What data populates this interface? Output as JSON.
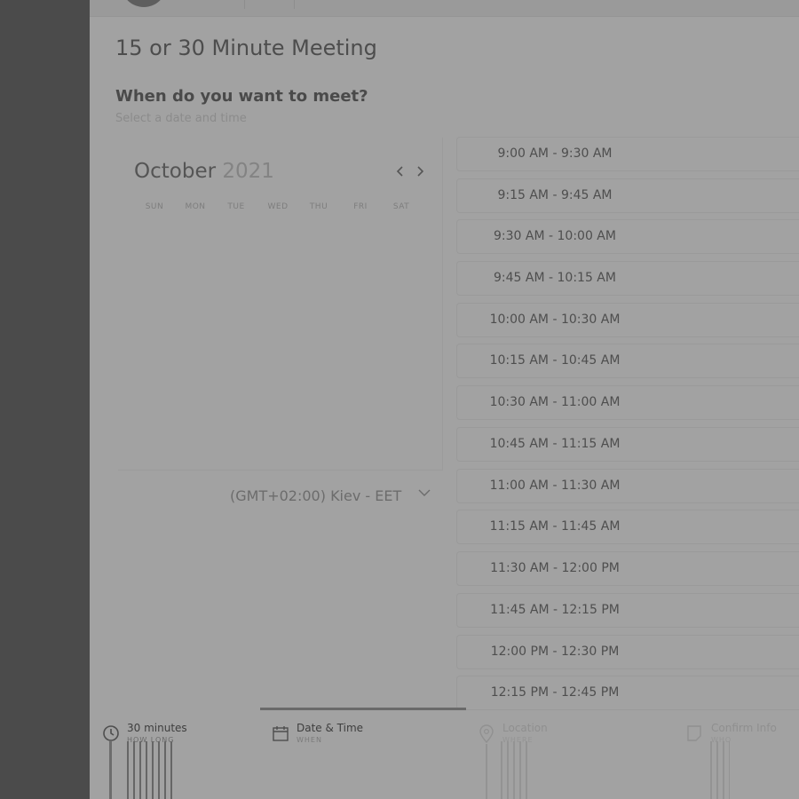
{
  "meeting": {
    "title": "15 or 30 Minute Meeting",
    "question": "When do you want to meet?",
    "hint": "Select a date and time"
  },
  "calendar": {
    "month": "October",
    "year": "2021",
    "prev_icon": "chevron-left-icon",
    "next_icon": "chevron-right-icon",
    "weekdays": [
      "SUN",
      "MON",
      "TUE",
      "WED",
      "THU",
      "FRI",
      "SAT"
    ]
  },
  "timezone": {
    "value": "(GMT+02:00) Kiev - EET",
    "icon": "chevron-down-icon"
  },
  "slots": [
    "9:00 AM - 9:30 AM",
    "9:15 AM - 9:45 AM",
    "9:30 AM - 10:00 AM",
    "9:45 AM - 10:15 AM",
    "10:00 AM - 10:30 AM",
    "10:15 AM - 10:45 AM",
    "10:30 AM - 11:00 AM",
    "10:45 AM - 11:15 AM",
    "11:00 AM - 11:30 AM",
    "11:15 AM - 11:45 AM",
    "11:30 AM - 12:00 PM",
    "11:45 AM - 12:15 PM",
    "12:00 PM - 12:30 PM",
    "12:15 PM - 12:45 PM"
  ],
  "steps": [
    {
      "label": "30 minutes",
      "sub": "HOW LONG",
      "icon": "clock-icon",
      "state": "done"
    },
    {
      "label": "Date & Time",
      "sub": "WHEN",
      "icon": "calendar-icon",
      "state": "active"
    },
    {
      "label": "Location",
      "sub": "WHERE",
      "icon": "location-pin-icon",
      "state": "upcoming"
    },
    {
      "label": "Confirm Info",
      "sub": "WHO",
      "icon": "note-icon",
      "state": "upcoming"
    }
  ],
  "colors": {
    "overlay_dark": "#4b4b4b",
    "panel": "#a2a2a2",
    "text_primary": "#4d4d4d",
    "text_muted": "#8b8b8b"
  }
}
